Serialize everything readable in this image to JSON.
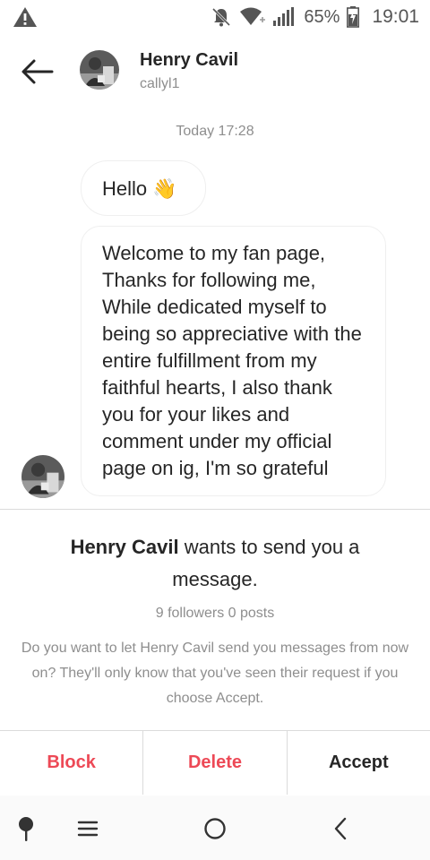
{
  "status_bar": {
    "battery_percent": "65%",
    "time": "19:01",
    "icons": [
      "warning-icon",
      "notifications-off-icon",
      "wifi-icon",
      "signal-icon",
      "battery-charging-icon"
    ]
  },
  "header": {
    "back_icon": "arrow-left-icon",
    "name": "Henry Cavil",
    "username": "callyl1"
  },
  "conversation": {
    "timestamp": "Today 17:28",
    "messages": [
      {
        "text": "Hello 👋"
      },
      {
        "text": "Welcome to my fan page, Thanks for following me, While dedicated myself to being so appreciative with the entire fulfillment from my faithful hearts, I also thank you for your likes and comment under my official page on ig, I'm so grateful"
      }
    ]
  },
  "request": {
    "sender_name": "Henry Cavil",
    "title_rest": " wants to send you a message.",
    "stats": "9 followers 0 posts",
    "description": "Do you want to let Henry Cavil send you messages from now on? They'll only know that you've seen their request if you choose Accept."
  },
  "actions": {
    "block": "Block",
    "delete": "Delete",
    "accept": "Accept"
  },
  "colors": {
    "danger": "#ed4956",
    "muted": "#8e8e8e",
    "text": "#262626"
  },
  "nav_bar": {
    "icons": [
      "pin-icon",
      "menu-icon",
      "home-circle-icon",
      "back-chevron-icon"
    ]
  }
}
